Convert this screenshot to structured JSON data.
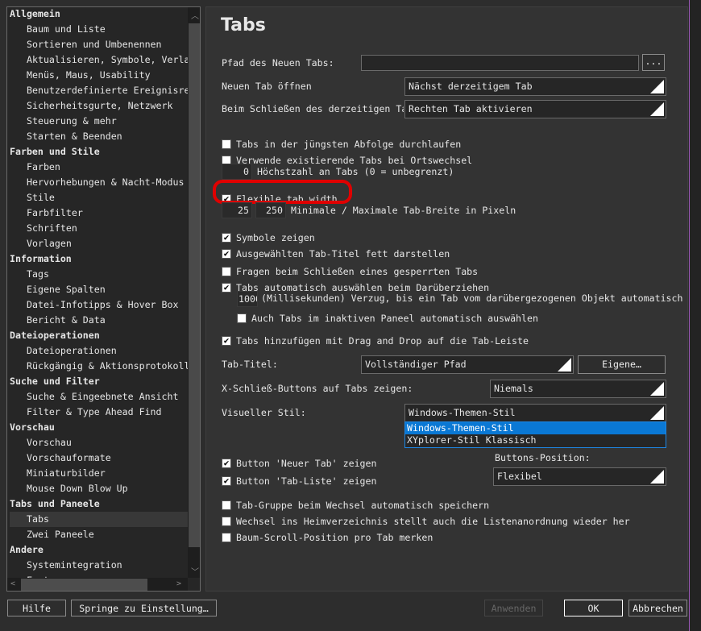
{
  "sidebar": {
    "items": [
      {
        "label": "Allgemein",
        "group": true
      },
      {
        "label": "Baum und Liste"
      },
      {
        "label": "Sortieren und Umbenennen"
      },
      {
        "label": "Aktualisieren, Symbole, Verlauf"
      },
      {
        "label": "Menüs, Maus, Usability"
      },
      {
        "label": "Benutzerdefinierte Ereignisreaktionen"
      },
      {
        "label": "Sicherheitsgurte, Netzwerk"
      },
      {
        "label": "Steuerung & mehr"
      },
      {
        "label": "Starten & Beenden"
      },
      {
        "label": "Farben und Stile",
        "group": true
      },
      {
        "label": "Farben"
      },
      {
        "label": "Hervorhebungen & Nacht-Modus"
      },
      {
        "label": "Stile"
      },
      {
        "label": "Farbfilter"
      },
      {
        "label": "Schriften"
      },
      {
        "label": "Vorlagen"
      },
      {
        "label": "Information",
        "group": true
      },
      {
        "label": "Tags"
      },
      {
        "label": "Eigene Spalten"
      },
      {
        "label": "Datei-Infotipps & Hover Box"
      },
      {
        "label": "Bericht & Data"
      },
      {
        "label": "Dateioperationen",
        "group": true
      },
      {
        "label": "Dateioperationen"
      },
      {
        "label": "Rückgängig & Aktionsprotokoll"
      },
      {
        "label": "Suche und Filter",
        "group": true
      },
      {
        "label": "Suche & Eingeebnete Ansicht"
      },
      {
        "label": "Filter & Type Ahead Find"
      },
      {
        "label": "Vorschau",
        "group": true
      },
      {
        "label": "Vorschau"
      },
      {
        "label": "Vorschauformate"
      },
      {
        "label": "Miniaturbilder"
      },
      {
        "label": "Mouse Down Blow Up"
      },
      {
        "label": "Tabs und Paneele",
        "group": true
      },
      {
        "label": "Tabs",
        "selected": true
      },
      {
        "label": "Zwei Paneele"
      },
      {
        "label": "Andere",
        "group": true
      },
      {
        "label": "Systemintegration"
      },
      {
        "label": "Features"
      }
    ]
  },
  "panel": {
    "title": "Tabs",
    "path_label": "Pfad des Neuen Tabs:",
    "path_value": "",
    "browse": "...",
    "open_label": "Neuen Tab öffnen",
    "open_value": "Nächst derzeitigem Tab",
    "close_label": "Beim Schließen des derzeitigen Tabs",
    "close_value": "Rechten Tab aktivieren",
    "cycle_label": "Tabs in der jüngsten Abfolge durchlaufen",
    "cycle": false,
    "reuse_label": "Verwende existierende Tabs bei Ortswechsel",
    "reuse": false,
    "max_value": "0",
    "max_label": "Höchstzahl an Tabs (0 = unbegrenzt)",
    "flex_label": "Flexible tab width",
    "flex": true,
    "min_width": "25",
    "max_width": "250",
    "width_label": "Minimale / Maximale Tab-Breite in Pixeln",
    "icons_label": "Symbole zeigen",
    "icons": true,
    "bold_label": "Ausgewählten Tab-Titel fett darstellen",
    "bold": true,
    "ask_label": "Fragen beim Schließen eines gesperrten Tabs",
    "ask": false,
    "auto_label": "Tabs automatisch auswählen beim Darüberziehen",
    "auto": true,
    "delay_value": "1000",
    "delay_label": "(Millisekunden) Verzug, bis ein Tab vom darübergezogenen Objekt automatisch ausgewählt wird",
    "inactive_label": "Auch Tabs im inaktiven Paneel automatisch auswählen",
    "inactive": false,
    "dnd_label": "Tabs hinzufügen mit Drag and Drop auf die Tab-Leiste",
    "dnd": true,
    "title_label": "Tab-Titel:",
    "title_value": "Vollständiger Pfad",
    "custom_btn": "Eigene…",
    "xclose_label": "X-Schließ-Buttons auf Tabs zeigen:",
    "xclose_value": "Niemals",
    "style_label": "Visueller Stil:",
    "style_value": "Windows-Themen-Stil",
    "style_options": [
      "Windows-Themen-Stil",
      "XYplorer-Stil Klassisch"
    ],
    "newtab_label": "Button 'Neuer Tab' zeigen",
    "newtab": true,
    "tablist_label": "Button 'Tab-Liste' zeigen",
    "tablist": true,
    "btnpos_label": "Buttons-Position:",
    "btnpos_value": "Flexibel",
    "group_label": "Tab-Gruppe beim Wechsel automatisch speichern",
    "group": false,
    "home_label": "Wechsel ins Heimverzeichnis stellt auch die Listenanordnung wieder her",
    "home": false,
    "scroll_label": "Baum-Scroll-Position pro Tab merken",
    "scroll": false
  },
  "footer": {
    "help": "Hilfe",
    "jump": "Springe zu Einstellung…",
    "apply": "Anwenden",
    "ok": "OK",
    "cancel": "Abbrechen"
  },
  "colors": {
    "highlight": "#e00000",
    "selection": "#0a78d4"
  }
}
